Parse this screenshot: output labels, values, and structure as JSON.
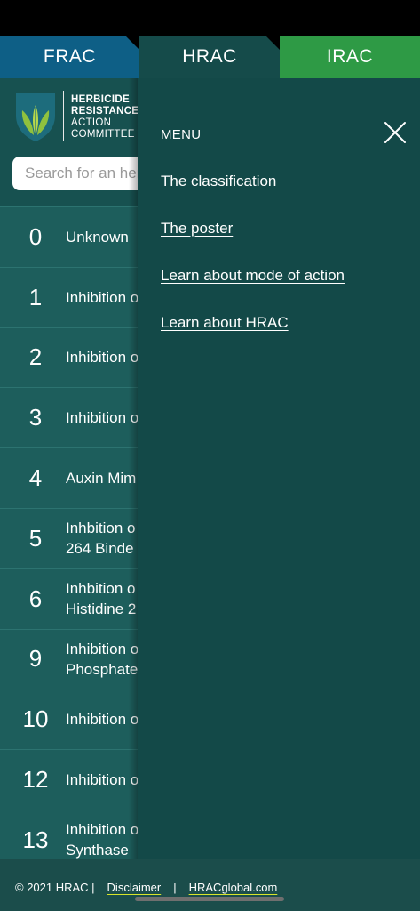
{
  "tabs": [
    {
      "label": "FRAC",
      "color": "#0e5f86"
    },
    {
      "label": "HRAC",
      "color": "#154b4a"
    },
    {
      "label": "IRAC",
      "color": "#2e9a45"
    }
  ],
  "header": {
    "logo_lines": [
      "HERBICIDE",
      "RESISTANCE",
      "ACTION",
      "COMMITTEE"
    ],
    "logo_icon": "leaf-shield-icon",
    "search_placeholder": "Search for an herbicide"
  },
  "list": [
    {
      "num": "0",
      "label": "Unknown"
    },
    {
      "num": "1",
      "label": "Inhibition o"
    },
    {
      "num": "2",
      "label": "Inhibition o"
    },
    {
      "num": "3",
      "label": "Inhibition o"
    },
    {
      "num": "4",
      "label": "Auxin Mim"
    },
    {
      "num": "5",
      "label": "Inhbition o\n264 Binde"
    },
    {
      "num": "6",
      "label": "Inhbition o\nHistidine 2"
    },
    {
      "num": "9",
      "label": "Inhibition o\nPhosphate"
    },
    {
      "num": "10",
      "label": "Inhibition o"
    },
    {
      "num": "12",
      "label": "Inhibition o"
    },
    {
      "num": "13",
      "label": "Inhibition o\nSynthase"
    }
  ],
  "menu": {
    "title": "MENU",
    "close_icon": "close-icon",
    "links": [
      "The classification",
      "The poster",
      "Learn about mode of action",
      "Learn about HRAC"
    ]
  },
  "footer": {
    "copyright": "© 2021 HRAC |",
    "disclaimer": "Disclaimer",
    "separator": "|",
    "site": "HRACglobal.com",
    "link_underline_color": "#d8e52a"
  }
}
